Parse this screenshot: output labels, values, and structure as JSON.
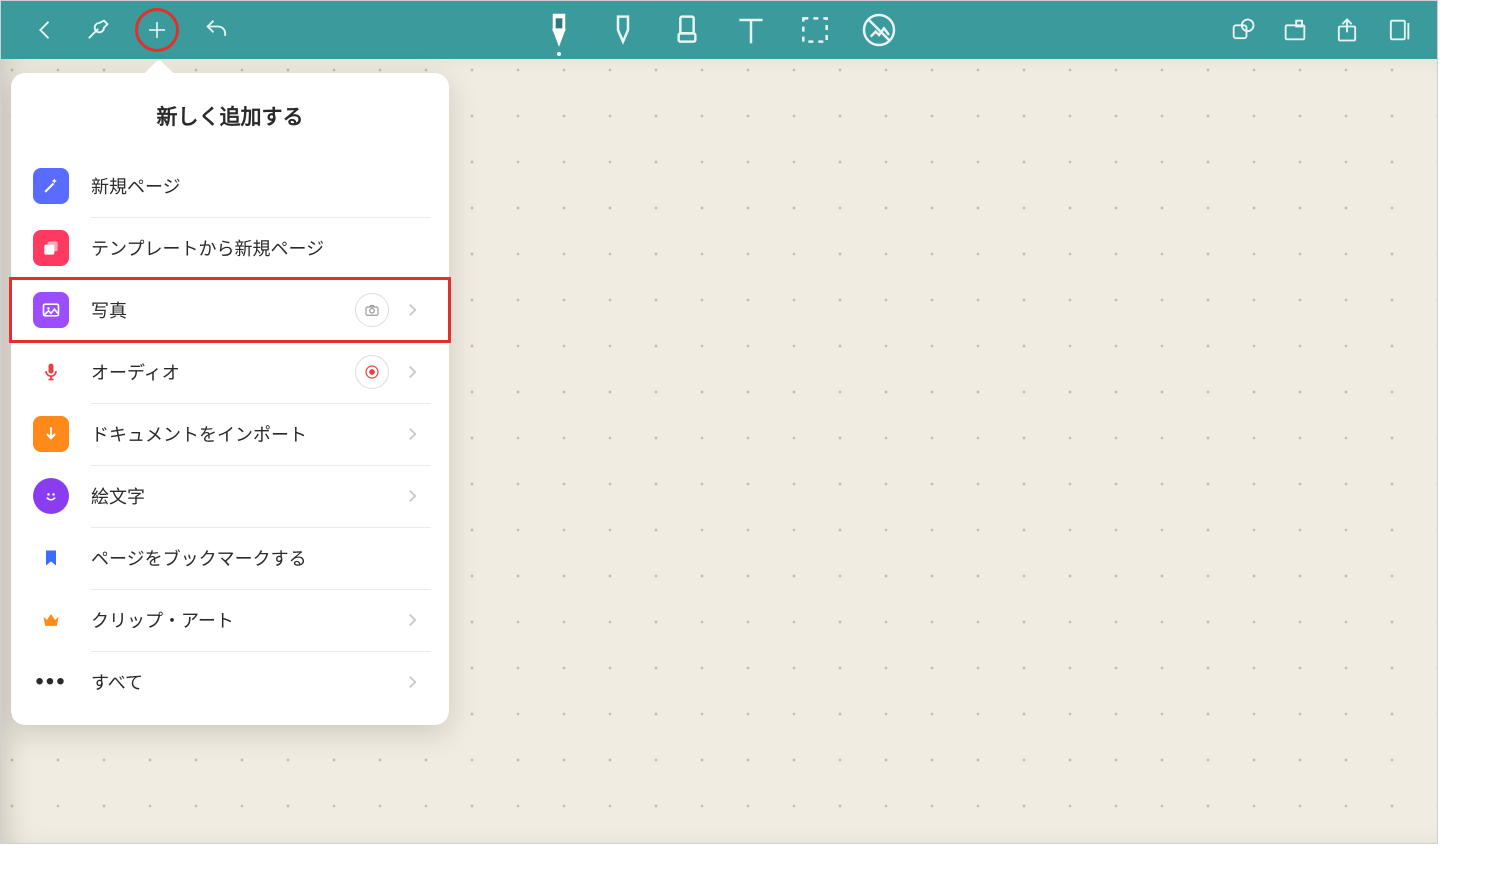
{
  "colors": {
    "toolbar": "#3a9a9c",
    "highlight": "#e03030",
    "canvas": "#f1ece2"
  },
  "popover": {
    "title": "新しく追加する",
    "items": [
      {
        "label": "新規ページ"
      },
      {
        "label": "テンプレートから新規ページ"
      },
      {
        "label": "写真"
      },
      {
        "label": "オーディオ"
      },
      {
        "label": "ドキュメントをインポート"
      },
      {
        "label": "絵文字"
      },
      {
        "label": "ページをブックマークする"
      },
      {
        "label": "クリップ・アート"
      },
      {
        "label": "すべて"
      }
    ]
  }
}
